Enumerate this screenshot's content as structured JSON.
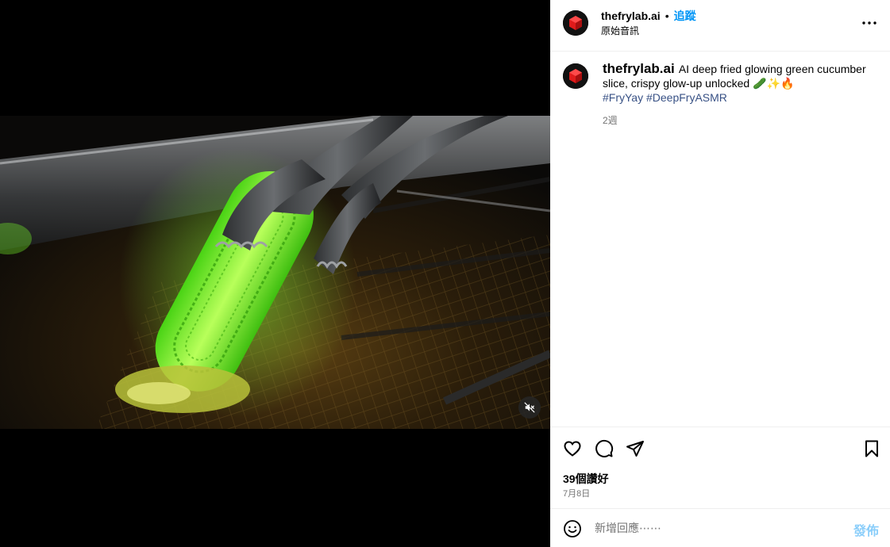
{
  "post": {
    "username": "thefrylab.ai",
    "separator": "•",
    "follow_label": "追蹤",
    "audio_label": "原始音訊",
    "caption_text": "AI deep fried glowing green cucumber slice, crispy glow-up unlocked 🥒✨🔥",
    "hashtags": [
      "#FryYay",
      "#DeepFryASMR"
    ],
    "caption_age": "2週",
    "likes": "39個讚好",
    "date": "7月8日"
  },
  "comment": {
    "placeholder": "新增回應⋯⋯",
    "post_label": "發佈"
  },
  "icons": {
    "more": "more-horizontal-icon",
    "like": "heart-icon",
    "comment": "comment-icon",
    "share": "send-icon",
    "save": "bookmark-icon",
    "emoji": "emoji-icon",
    "mute": "speaker-muted-icon"
  },
  "colors": {
    "accent": "#0095f6",
    "hashtag": "#385185",
    "muted_text": "#737373",
    "divider": "#efefef"
  }
}
